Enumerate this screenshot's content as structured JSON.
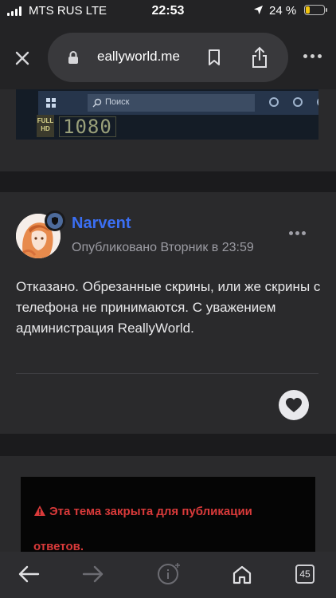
{
  "status_bar": {
    "carrier": "MTS RUS  LTE",
    "time": "22:53",
    "battery": "24 %",
    "battery_level": 0.24
  },
  "browser": {
    "url": "eallyworld.me"
  },
  "previous_post": {
    "search_label": "Поиск",
    "hd_badge": "FULL HD",
    "resolution_label": "1080"
  },
  "post": {
    "author": "Narvent",
    "published": "Опубликовано Вторник в 23:59",
    "body": "Отказано. Обрезанные скрины, или же скрины с телефона не принимаются. С уважением администрация ReallyWorld."
  },
  "topic_notice": {
    "text": "Эта тема закрыта для публикации ответов."
  },
  "toolbar": {
    "tabs_count": "45"
  },
  "colors": {
    "accent": "#3b6ff3",
    "warning": "#d93a3a",
    "background": "#1f1f21",
    "card": "#2a2a2c"
  }
}
